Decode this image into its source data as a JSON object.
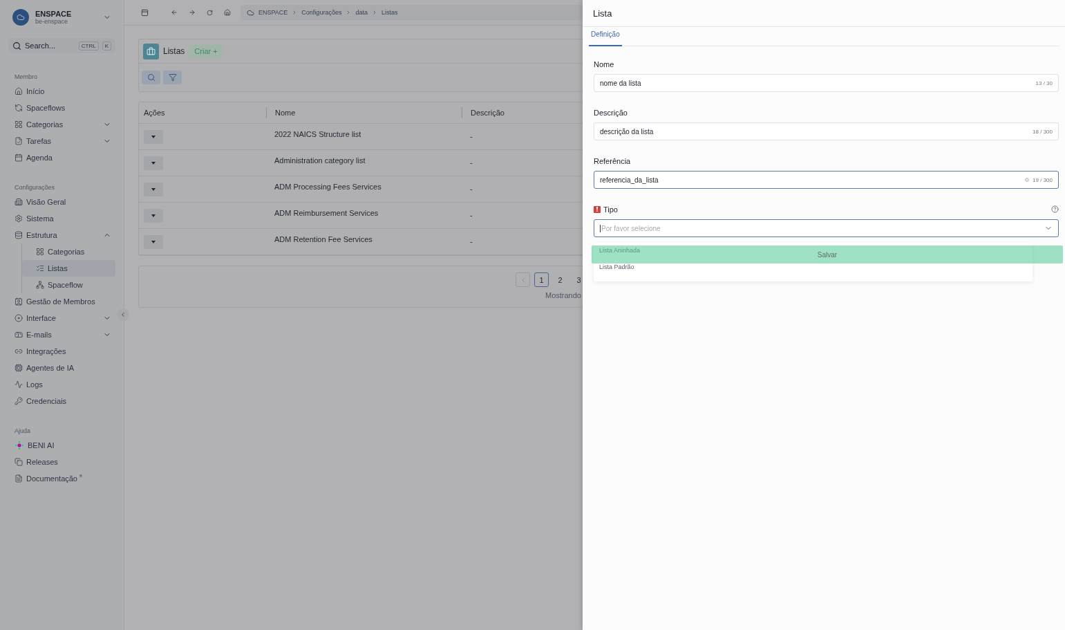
{
  "workspace": {
    "name": "ENSPACE",
    "subtitle": "be-enspace"
  },
  "search": {
    "placeholder": "Search...",
    "keys": [
      "CTRL",
      "K"
    ]
  },
  "sidebar": {
    "sections": [
      {
        "title": "Membro",
        "items": [
          {
            "label": "Início",
            "selected": false
          },
          {
            "label": "Spaceflows",
            "selected": false
          },
          {
            "label": "Categorias",
            "expanded": false,
            "selected": false
          },
          {
            "label": "Tarefas",
            "expanded": false,
            "selected": false
          },
          {
            "label": "Agenda",
            "selected": false
          }
        ]
      },
      {
        "title": "Configurações",
        "items": [
          {
            "label": "Visão Geral",
            "selected": false
          },
          {
            "label": "Sistema",
            "selected": false
          },
          {
            "label": "Estrutura",
            "expanded": true,
            "selected": false,
            "children": [
              {
                "label": "Categorias",
                "selected": false
              },
              {
                "label": "Listas",
                "selected": true
              },
              {
                "label": "Spaceflow",
                "selected": false
              }
            ]
          },
          {
            "label": "Gestão de Membros",
            "selected": false
          },
          {
            "label": "Interface",
            "expanded": false,
            "selected": false
          },
          {
            "label": "E-mails",
            "expanded": false,
            "selected": false
          },
          {
            "label": "Integrações",
            "selected": false
          },
          {
            "label": "Agentes de IA",
            "selected": false
          },
          {
            "label": "Logs",
            "selected": false
          },
          {
            "label": "Credenciais",
            "selected": false
          }
        ]
      },
      {
        "title": "Ajuda",
        "items": [
          {
            "label": "BENI AI",
            "selected": false
          },
          {
            "label": "Releases",
            "selected": false
          },
          {
            "label": "Documentação",
            "selected": false,
            "external": true
          }
        ]
      }
    ]
  },
  "breadcrumb": [
    "ENSPACE",
    "Configurações",
    "data",
    "Listas"
  ],
  "page": {
    "title": "Listas",
    "create_button": "Criar +"
  },
  "table": {
    "columns": [
      "Ações",
      "Nome",
      "Descrição"
    ],
    "rows": [
      {
        "name": "2022 NAICS Structure list",
        "description": "-"
      },
      {
        "name": "Administration category list",
        "description": "-"
      },
      {
        "name": "ADM Processing Fees Services",
        "description": "-"
      },
      {
        "name": "ADM Reimbursement Services",
        "description": "-"
      },
      {
        "name": "ADM Retention Fee Services",
        "description": "-"
      }
    ]
  },
  "pagination": {
    "pages": [
      {
        "label": "1",
        "selected": true
      },
      {
        "label": "2",
        "selected": false
      },
      {
        "label": "3",
        "selected": false
      }
    ],
    "summary": "Mostrando"
  },
  "drawer": {
    "title": "Lista",
    "tabs": [
      {
        "label": "Definição",
        "selected": true
      }
    ],
    "fields": [
      {
        "label": "Nome",
        "value": "nome da lista",
        "counter": "13 / 30",
        "focused": false,
        "clearable": false
      },
      {
        "label": "Descrição",
        "value": "descrição da lista",
        "counter": "18 / 300",
        "focused": false,
        "clearable": false
      },
      {
        "label": "Referência",
        "value": "referencia_da_lista",
        "counter": "19 / 300",
        "focused": true,
        "clearable": true
      }
    ],
    "select": {
      "label": "Tipo",
      "required": true,
      "placeholder": "Por favor selecione",
      "options": [
        "Lista Aninhada",
        "Lista Padrão"
      ]
    },
    "save_button": "Salvar"
  }
}
